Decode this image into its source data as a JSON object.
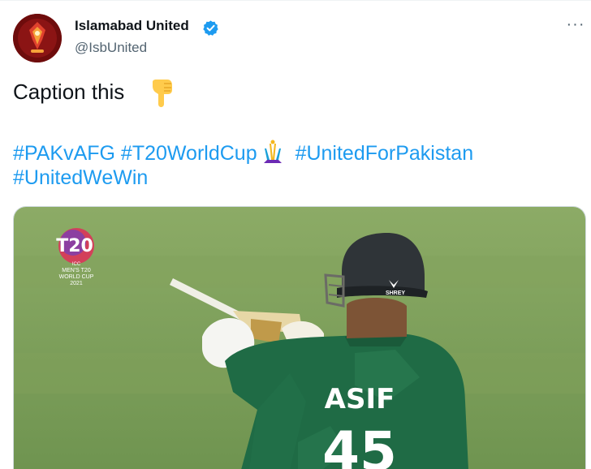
{
  "tweet": {
    "author_name": "Islamabad United",
    "author_handle": "@IsbUnited",
    "caption": "Caption this",
    "hashtags_line1": [
      "#PAKvAFG",
      "#T20WorldCup",
      "#UnitedForPakistan"
    ],
    "hashtags_line2": [
      "#UnitedWeWin"
    ],
    "more_label": "···"
  },
  "media": {
    "logo_line1": "T20",
    "logo_line2": "ICC",
    "logo_line3": "MEN'S T20",
    "logo_line4": "WORLD CUP",
    "logo_line5": "2021",
    "jersey_name": "ASIF",
    "jersey_number": "45",
    "helmet_brand": "SHREY"
  },
  "colors": {
    "link": "#1d9bf0",
    "text": "#0f1419",
    "muted": "#536471",
    "verified": "#1d9bf0",
    "jersey": "#1f6b45",
    "pitch": "#7fa05a"
  },
  "icons": [
    "verified-badge-icon",
    "pointing-down-emoji-icon",
    "t20-trophy-icon",
    "more-options-icon"
  ]
}
